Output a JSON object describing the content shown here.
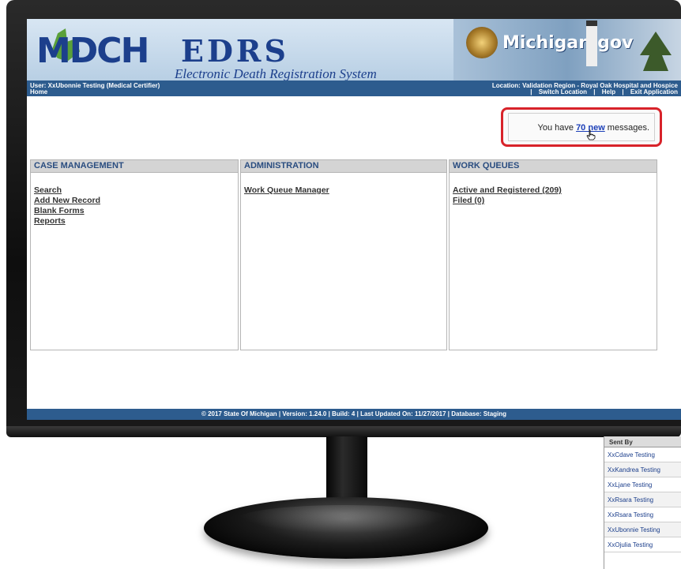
{
  "banner": {
    "logo_text": "MDCH",
    "title": "EDRS",
    "subtitle": "Electronic Death Registration System",
    "michigan_gov": "Michigan.gov"
  },
  "userbar": {
    "user": "User: XxUbonnie Testing (Medical Certifier)",
    "home": "Home",
    "location": "Location: Validation Region - Royal Oak Hospital and Hospice",
    "links": [
      "Switch Location",
      "Help",
      "Exit Application"
    ]
  },
  "messages": {
    "prefix": "You have ",
    "count": "70 new",
    "suffix": " messages."
  },
  "panels": [
    {
      "title": "CASE MANAGEMENT",
      "links": [
        {
          "label": "Search",
          "count": ""
        },
        {
          "label": "Add New Record",
          "count": ""
        },
        {
          "label": "Blank Forms",
          "count": ""
        },
        {
          "label": "Reports",
          "count": ""
        }
      ]
    },
    {
      "title": "ADMINISTRATION",
      "links": [
        {
          "label": "Work Queue Manager",
          "count": ""
        }
      ]
    },
    {
      "title": "WORK QUEUES",
      "links": [
        {
          "label": "Active and Registered ",
          "count": "(209)"
        },
        {
          "label": "Filed ",
          "count": "(0)"
        }
      ]
    }
  ],
  "footer": "© 2017 State Of Michigan | Version: 1.24.0 | Build: 4 | Last Updated On: 11/27/2017 | Database: Staging",
  "side_grid": {
    "header": "Sent By",
    "rows": [
      "XxCdave Testing",
      "XxKandrea Testing",
      "XxLjane Testing",
      "XxRsara Testing",
      "XxRsara Testing",
      "XxUbonnie Testing",
      "XxOjulia Testing"
    ]
  },
  "colors": {
    "accent_blue": "#2d5c8e",
    "highlight_red": "#d8232a",
    "link_blue": "#1c3fb8"
  }
}
